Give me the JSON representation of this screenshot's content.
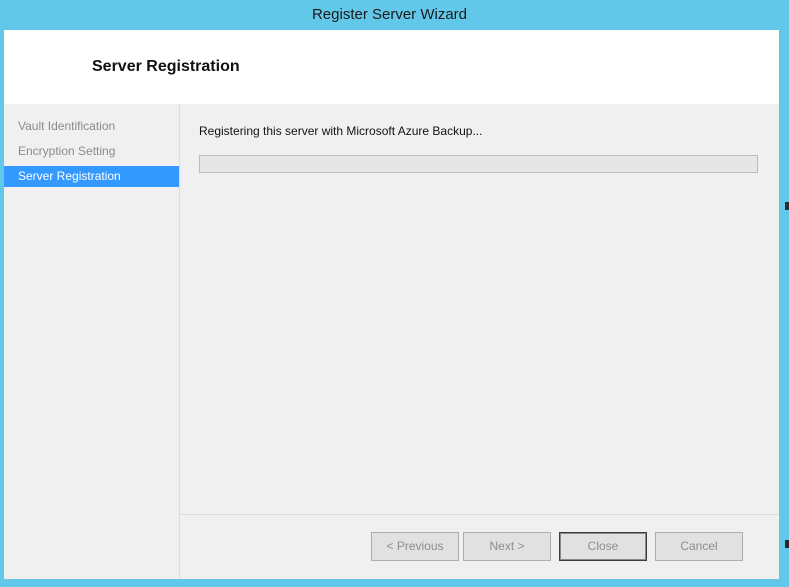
{
  "window": {
    "title": "Register Server Wizard"
  },
  "header": {
    "title": "Server Registration"
  },
  "sidebar": {
    "items": [
      {
        "label": "Vault Identification",
        "active": false
      },
      {
        "label": "Encryption Setting",
        "active": false
      },
      {
        "label": "Server Registration",
        "active": true
      }
    ]
  },
  "main": {
    "status_text": "Registering this server with Microsoft Azure Backup...",
    "progress": 0
  },
  "buttons": {
    "previous": "< Previous",
    "next": "Next >",
    "close": "Close",
    "cancel": "Cancel"
  },
  "colors": {
    "window_frame": "#62c8ea",
    "selection": "#3399ff"
  }
}
